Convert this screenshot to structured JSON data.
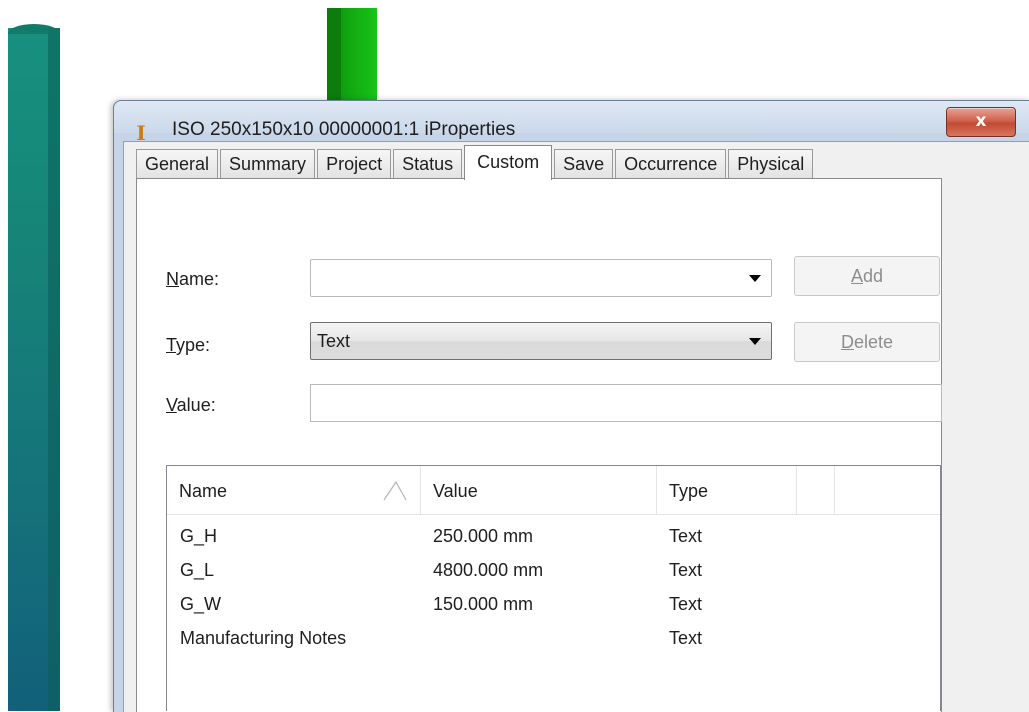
{
  "window": {
    "title": "ISO 250x150x10 00000001:1 iProperties",
    "app_icon": "I",
    "close_glyph": "x"
  },
  "tabs": [
    {
      "label": "General"
    },
    {
      "label": "Summary"
    },
    {
      "label": "Project"
    },
    {
      "label": "Status"
    },
    {
      "label": "Custom",
      "active": true
    },
    {
      "label": "Save"
    },
    {
      "label": "Occurrence"
    },
    {
      "label": "Physical"
    }
  ],
  "form": {
    "name_label_mnemonic": "N",
    "name_label_rest": "ame:",
    "name_value": "",
    "type_label_mnemonic": "T",
    "type_label_rest": "ype:",
    "type_value": "Text",
    "value_label_mnemonic": "V",
    "value_label_rest": "alue:",
    "value_value": "",
    "add_mnemonic": "A",
    "add_rest": "dd",
    "delete_mnemonic": "D",
    "delete_rest": "elete"
  },
  "list": {
    "columns": [
      "Name",
      "Value",
      "Type"
    ],
    "rows": [
      {
        "name": "G_H",
        "value": "250.000 mm",
        "type": "Text"
      },
      {
        "name": "G_L",
        "value": "4800.000 mm",
        "type": "Text"
      },
      {
        "name": "G_W",
        "value": "150.000 mm",
        "type": "Text"
      },
      {
        "name": "Manufacturing Notes",
        "value": "",
        "type": "Text"
      }
    ]
  },
  "colors": {
    "accent_title": "#c5d4e6",
    "close_button": "#c34a35",
    "beam_left": "#168578",
    "beam_green": "#11a811"
  }
}
